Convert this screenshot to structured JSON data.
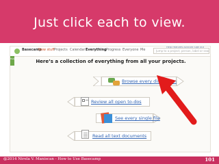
{
  "slide": {
    "title": "Just click each to view.",
    "footer": "@2014 Nirela V. Maniscan - How to Use Basecamp",
    "page_number": "101"
  },
  "app": {
    "brand": "Basecamp",
    "new_stuff": "New stuff",
    "nav_items": [
      "Projects",
      "Calendar",
      "Everything",
      "Progress",
      "Everyone",
      "Me"
    ],
    "active_nav": "Everything",
    "search_placeholder": "Jump to a project, person, label or search",
    "top_links": "Help Features  Account  Sign out",
    "side_tab": "Help"
  },
  "page": {
    "intro": "Here’s a collection of everything from all your projects.",
    "actions": [
      {
        "label": "Browse every discussion",
        "icon": "discussion-bubbles-icon"
      },
      {
        "label": "Review all open to-dos",
        "icon": "todo-checklist-icon"
      },
      {
        "label": "See every single file",
        "icon": "files-icon"
      },
      {
        "label": "Read all text documents",
        "icon": "text-document-icon"
      }
    ]
  },
  "colors": {
    "header_pink": "#d63a6a",
    "footer_pink": "#c92f5f",
    "arrow_red": "#e21b1b",
    "link_blue": "#2f63b3"
  }
}
